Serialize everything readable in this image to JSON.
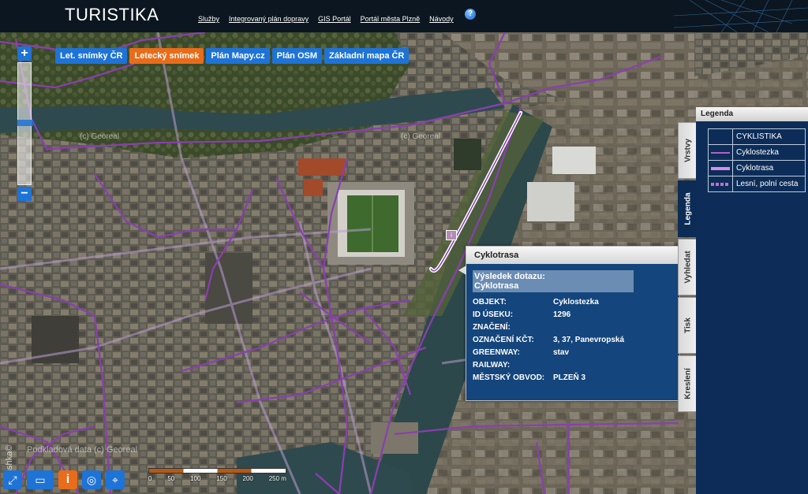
{
  "app": {
    "title": "TURISTIKA"
  },
  "nav": [
    {
      "label": "Služby"
    },
    {
      "label": "Integrovaný plán dopravy"
    },
    {
      "label": "GIS Portál"
    },
    {
      "label": "Portál města Plzně"
    },
    {
      "label": "Návody"
    }
  ],
  "help": {
    "glyph": "?"
  },
  "layers": [
    {
      "label": "Let. snímky ČR",
      "active": false
    },
    {
      "label": "Letecký snímek",
      "active": true
    },
    {
      "label": "Plán Mapy.cz",
      "active": false
    },
    {
      "label": "Plán OSM",
      "active": false
    },
    {
      "label": "Základní mapa ČR",
      "active": false
    }
  ],
  "zoom": {
    "in": "+",
    "out": "−"
  },
  "watermarks": {
    "georeal_1": "(c) Georeal",
    "georeal_2": "(c) Georeal",
    "podklad": "Podkladová data (c) Georeal",
    "brand": "Marushka©"
  },
  "scale": {
    "ticks": [
      "0",
      "50",
      "100",
      "150",
      "200",
      "250 m"
    ]
  },
  "popup": {
    "title": "Cyklotrasa",
    "result_line1": "Výsledek dotazu:",
    "result_line2": "Cyklotrasa",
    "rows": [
      {
        "key": "OBJEKT:",
        "value": "Cyklostezka"
      },
      {
        "key": "ID ÚSEKU:",
        "value": "1296"
      },
      {
        "key": "ZNAČENÍ:",
        "value": ""
      },
      {
        "key": "OZNAČENÍ KČT:",
        "value": "3, 37, Panevropská"
      },
      {
        "key": "GREENWAY:",
        "value": "stav"
      },
      {
        "key": "RAILWAY:",
        "value": ""
      },
      {
        "key": "MĚSTSKÝ OBVOD:",
        "value": "PLZEŇ 3"
      }
    ]
  },
  "side_tabs": [
    {
      "label": "Vrstvy",
      "active": false
    },
    {
      "label": "Legenda",
      "active": true
    },
    {
      "label": "Vyhledat",
      "active": false
    },
    {
      "label": "Tisk",
      "active": false
    },
    {
      "label": "Kreslení",
      "active": false
    }
  ],
  "legend": {
    "title": "Legenda",
    "heading": "CYKLISTIKA",
    "items": [
      {
        "label": "Cyklostezka",
        "color": "#b061c8"
      },
      {
        "label": "Cyklotrasa",
        "color": "#d48ee6"
      },
      {
        "label": "Lesní, polní cesta",
        "color": "#c070d0"
      }
    ]
  },
  "tools": {
    "fullscreen": "⤢",
    "measure": "▭",
    "info": "i",
    "gps": "◎",
    "locate": "⌖"
  },
  "colors": {
    "accent": "#1e73d6",
    "active": "#e86c1a",
    "route": "#8a3fb0",
    "highlight": "#ffffff"
  }
}
